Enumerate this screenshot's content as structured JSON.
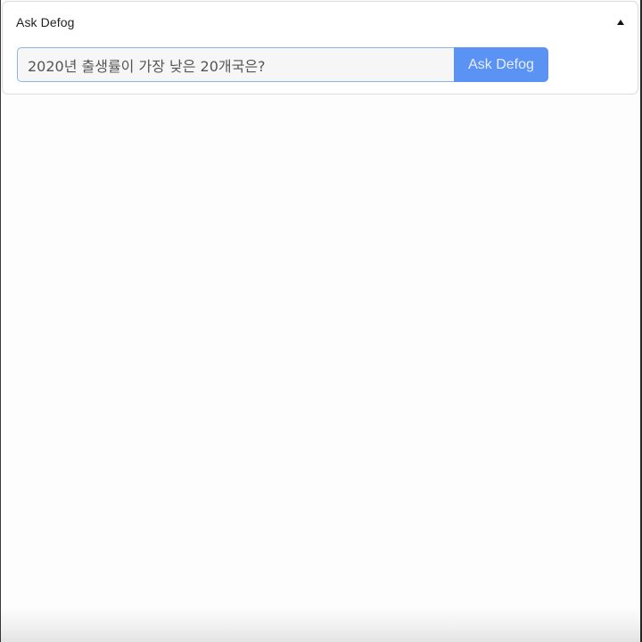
{
  "panel": {
    "title": "Ask Defog",
    "collapse_icon": "caret-up-icon"
  },
  "search": {
    "query_value": "2020년 출생률이 가장 낮은 20개국은?",
    "button_label": "Ask Defog"
  },
  "colors": {
    "button_bg": "#5b93f5",
    "input_border": "#8ab4e6",
    "input_bg": "#f6f6f6"
  }
}
